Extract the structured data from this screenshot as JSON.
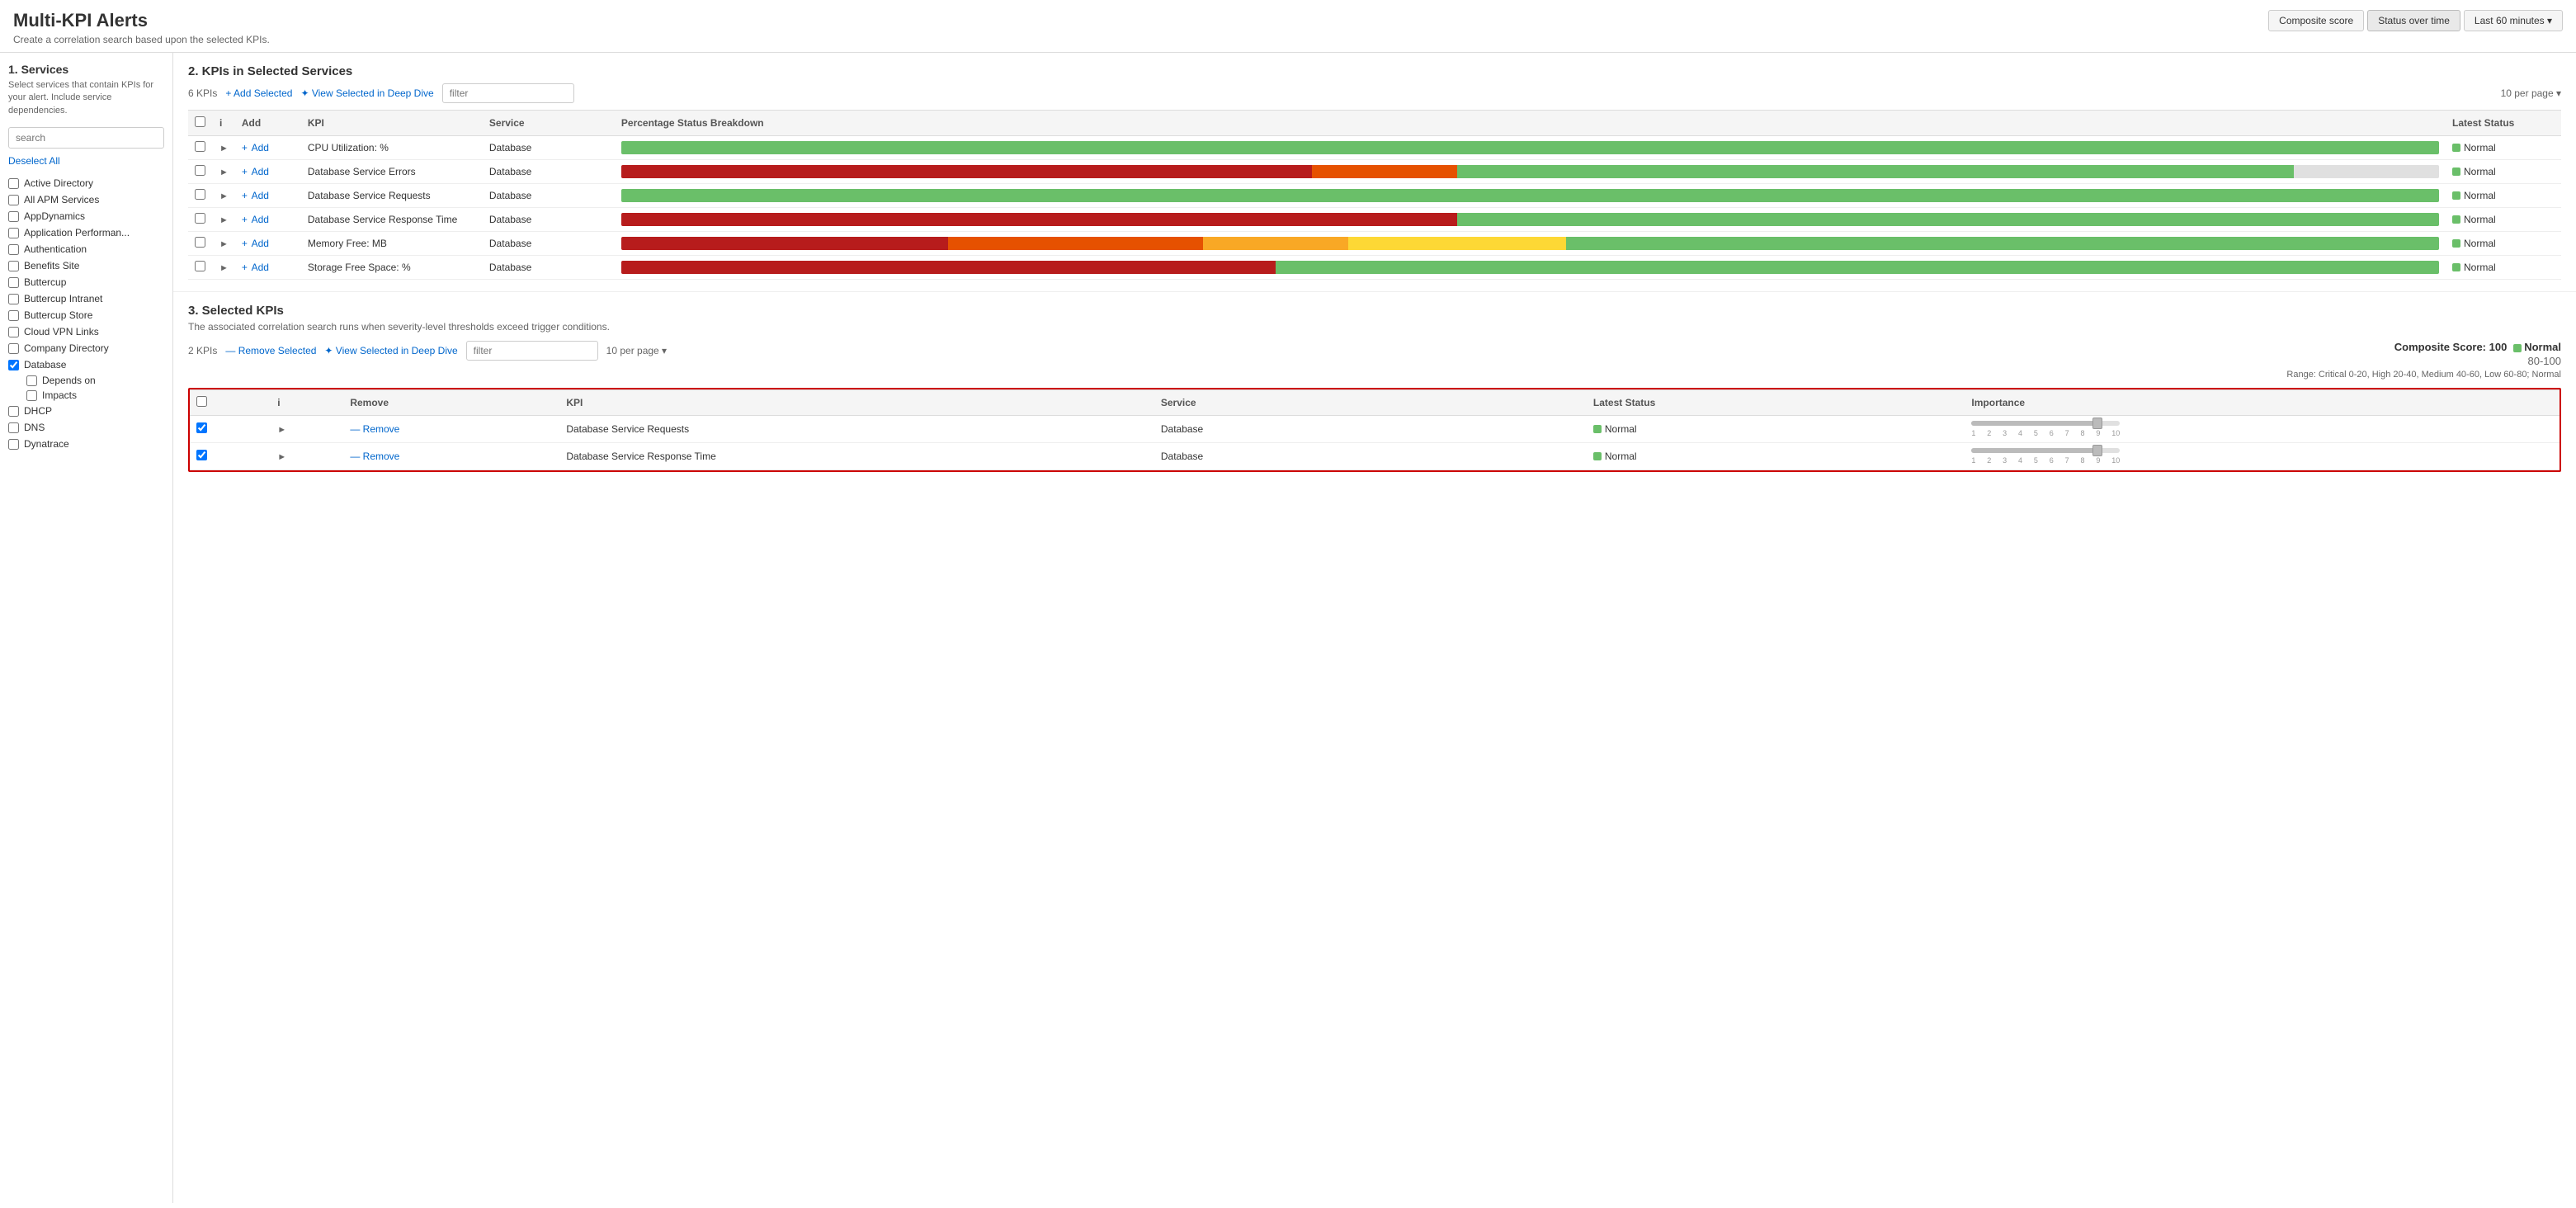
{
  "header": {
    "title": "Multi-KPI Alerts",
    "subtitle": "Create a correlation search based upon the selected KPIs.",
    "buttons": [
      {
        "label": "Composite score",
        "active": false
      },
      {
        "label": "Status over time",
        "active": true
      },
      {
        "label": "Last 60 minutes ▾",
        "active": false
      }
    ]
  },
  "sidebar": {
    "title": "1. Services",
    "description": "Select services that contain KPIs for your alert. Include service dependencies.",
    "search_placeholder": "search",
    "deselect_all": "Deselect All",
    "services": [
      {
        "name": "Active Directory",
        "checked": false
      },
      {
        "name": "All APM Services",
        "checked": false
      },
      {
        "name": "AppDynamics",
        "checked": false
      },
      {
        "name": "Application Performan...",
        "checked": false
      },
      {
        "name": "Authentication",
        "checked": false
      },
      {
        "name": "Benefits Site",
        "checked": false
      },
      {
        "name": "Buttercup",
        "checked": false
      },
      {
        "name": "Buttercup Intranet",
        "checked": false
      },
      {
        "name": "Buttercup Store",
        "checked": false
      },
      {
        "name": "Cloud VPN Links",
        "checked": false
      },
      {
        "name": "Company Directory",
        "checked": false
      },
      {
        "name": "Database",
        "checked": true,
        "sub": [
          "Depends on",
          "Impacts"
        ]
      },
      {
        "name": "DHCP",
        "checked": false
      },
      {
        "name": "DNS",
        "checked": false
      },
      {
        "name": "Dynatrace",
        "checked": false
      }
    ]
  },
  "kpis_section": {
    "title": "2. KPIs in Selected Services",
    "count": "6 KPIs",
    "add_selected": "+ Add Selected",
    "view_deep_dive": "✦ View Selected in Deep Dive",
    "filter_placeholder": "filter",
    "per_page": "10 per page ▾",
    "columns": [
      "",
      "",
      "Add",
      "KPI",
      "Service",
      "Percentage Status Breakdown",
      "Latest Status"
    ],
    "rows": [
      {
        "kpi": "CPU Utilization: %",
        "service": "Database",
        "bars": [
          {
            "color": "#6abf69",
            "pct": 100
          }
        ],
        "status": "Normal"
      },
      {
        "kpi": "Database Service Errors",
        "service": "Database",
        "bars": [
          {
            "color": "#b71c1c",
            "pct": 38
          },
          {
            "color": "#e65100",
            "pct": 8
          },
          {
            "color": "#6abf69",
            "pct": 46
          },
          {
            "color": "#e0e0e0",
            "pct": 8
          }
        ],
        "status": "Normal"
      },
      {
        "kpi": "Database Service Requests",
        "service": "Database",
        "bars": [
          {
            "color": "#6abf69",
            "pct": 100
          }
        ],
        "status": "Normal"
      },
      {
        "kpi": "Database Service Response Time",
        "service": "Database",
        "bars": [
          {
            "color": "#b71c1c",
            "pct": 46
          },
          {
            "color": "#6abf69",
            "pct": 54
          }
        ],
        "status": "Normal"
      },
      {
        "kpi": "Memory Free: MB",
        "service": "Database",
        "bars": [
          {
            "color": "#b71c1c",
            "pct": 18
          },
          {
            "color": "#e65100",
            "pct": 14
          },
          {
            "color": "#f9a825",
            "pct": 8
          },
          {
            "color": "#fdd835",
            "pct": 12
          },
          {
            "color": "#6abf69",
            "pct": 48
          }
        ],
        "status": "Normal"
      },
      {
        "kpi": "Storage Free Space: %",
        "service": "Database",
        "bars": [
          {
            "color": "#b71c1c",
            "pct": 36
          },
          {
            "color": "#6abf69",
            "pct": 64
          }
        ],
        "status": "Normal"
      }
    ]
  },
  "selected_section": {
    "title": "3. Selected KPIs",
    "description": "The associated correlation search runs when severity-level thresholds exceed trigger conditions.",
    "composite_label": "Composite Score:",
    "composite_value": "100",
    "composite_status": "Normal",
    "score_range_label": "80-100",
    "range_desc": "Range: Critical 0-20, High 20-40, Medium 40-60, Low 60-80; Normal",
    "count": "2 KPIs",
    "remove_selected": "— Remove Selected",
    "view_deep_dive": "✦ View Selected in Deep Dive",
    "filter_placeholder": "filter",
    "per_page": "10 per page ▾",
    "columns": [
      "",
      "",
      "Remove",
      "KPI",
      "Service",
      "Latest Status",
      "Importance"
    ],
    "scale_numbers": [
      "1",
      "2",
      "3",
      "4",
      "5",
      "6",
      "7",
      "8",
      "9",
      "10"
    ],
    "rows": [
      {
        "kpi": "Database Service Requests",
        "service": "Database",
        "status": "Normal",
        "checked": true,
        "slider_pct": 85
      },
      {
        "kpi": "Database Service Response Time",
        "service": "Database",
        "status": "Normal",
        "checked": true,
        "slider_pct": 85
      }
    ]
  }
}
